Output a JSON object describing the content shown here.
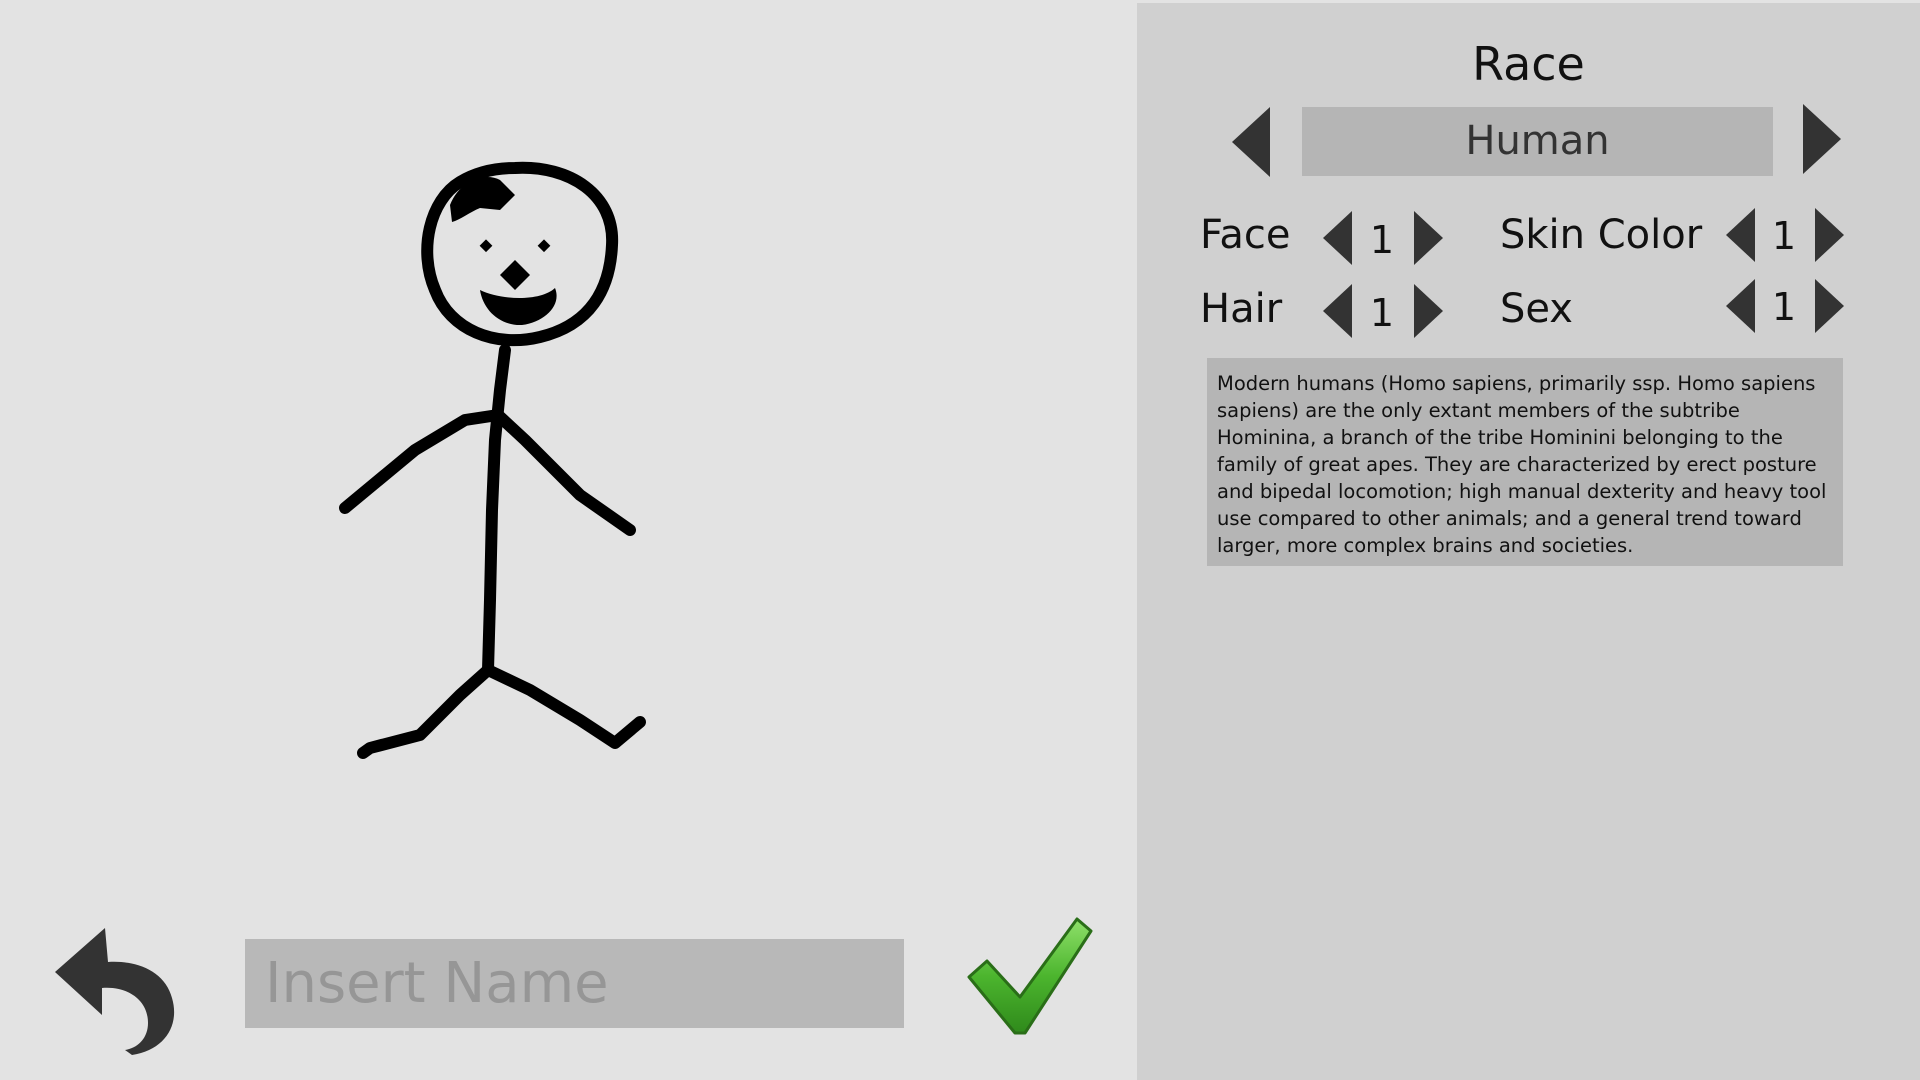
{
  "name_input": {
    "placeholder": "Insert Name",
    "value": ""
  },
  "race": {
    "title": "Race",
    "value": "Human"
  },
  "options": {
    "face": {
      "label": "Face",
      "value": "1"
    },
    "hair": {
      "label": "Hair",
      "value": "1"
    },
    "skin_color": {
      "label": "Skin Color",
      "value": "1"
    },
    "sex": {
      "label": "Sex",
      "value": "1"
    }
  },
  "description": "Modern humans (Homo sapiens, primarily ssp. Homo sapiens sapiens) are the only extant members of the subtribe Hominina, a branch of the tribe Hominini belonging to the family of great apes. They are characterized by erect posture and bipedal locomotion; high manual dexterity and heavy tool use compared to other animals; and a general trend toward larger, more complex brains and societies.",
  "icons": {
    "back": "undo-arrow-icon",
    "confirm": "checkmark-icon",
    "prev": "triangle-left-icon",
    "next": "triangle-right-icon"
  },
  "colors": {
    "background": "#e3e3e3",
    "panel": "#d0d0d0",
    "field": "#b5b5b5",
    "arrow": "#333333",
    "confirm_green": "#4cb52e"
  }
}
